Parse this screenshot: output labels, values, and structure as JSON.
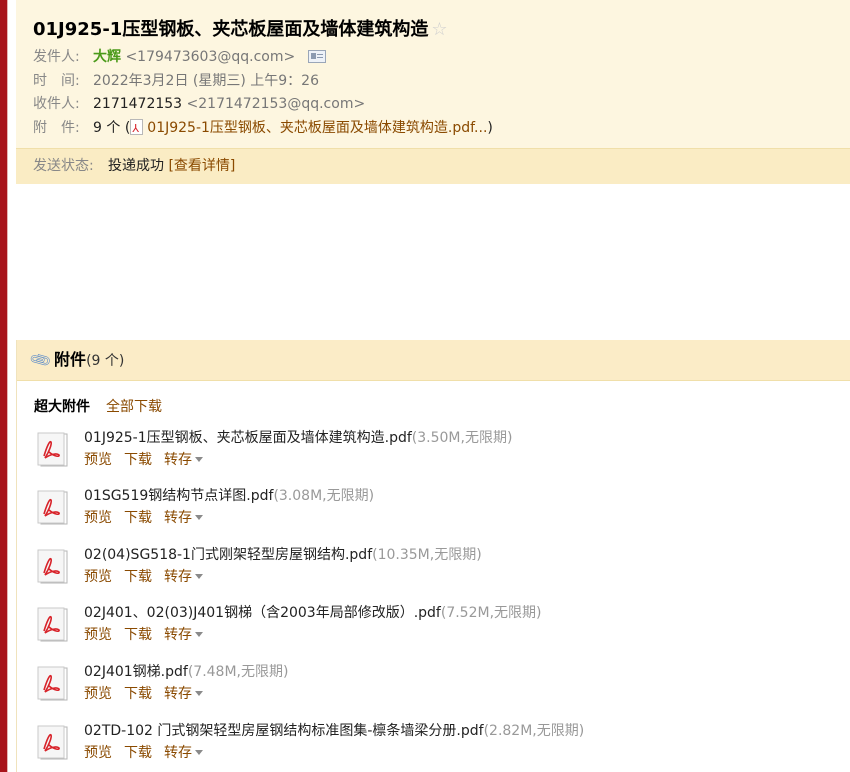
{
  "email": {
    "subject": "01J925-1压型钢板、夹芯板屋面及墙体建筑构造",
    "star": "☆",
    "sender": {
      "label": "发件人:",
      "name": "大辉",
      "address": "<179473603@qq.com>"
    },
    "time": {
      "label": "时　间:",
      "value": "2022年3月2日 (星期三) 上午9：26"
    },
    "recipient": {
      "label": "收件人:",
      "name": "2171472153",
      "address": "<2171472153@qq.com>"
    },
    "attachments_summary": {
      "label": "附　件:",
      "count": "9 个",
      "open_paren": "(",
      "first_file": "01J925-1压型钢板、夹芯板屋面及墙体建筑构造.pdf...",
      "close_paren": ")"
    },
    "status": {
      "label": "发送状态:",
      "value": "投递成功",
      "details": "[查看详情]"
    }
  },
  "attachments": {
    "title": "附件",
    "count": "(9 个)",
    "section_title": "超大附件",
    "download_all": "全部下载",
    "actions": {
      "preview": "预览",
      "download": "下载",
      "save": "转存"
    },
    "files": [
      {
        "name": "01J925-1压型钢板、夹芯板屋面及墙体建筑构造.pdf",
        "meta": "(3.50M,无限期)"
      },
      {
        "name": "01SG519钢结构节点详图.pdf",
        "meta": "(3.08M,无限期)"
      },
      {
        "name": "02(04)SG518-1门式刚架轻型房屋钢结构.pdf",
        "meta": "(10.35M,无限期)"
      },
      {
        "name": "02J401、02(03)J401钢梯（含2003年局部修改版）.pdf",
        "meta": "(7.52M,无限期)"
      },
      {
        "name": "02J401钢梯.pdf",
        "meta": "(7.48M,无限期)"
      },
      {
        "name": "02TD-102 门式钢架轻型房屋钢结构标准图集-檩条墙梁分册.pdf",
        "meta": "(2.82M,无限期)"
      }
    ]
  },
  "colors": {
    "accent_bar": "#a8141b",
    "header_bg": "#fdf6e0",
    "status_bg": "#faecc4",
    "link": "#8a4a00",
    "sender_green": "#4b9a1a"
  }
}
